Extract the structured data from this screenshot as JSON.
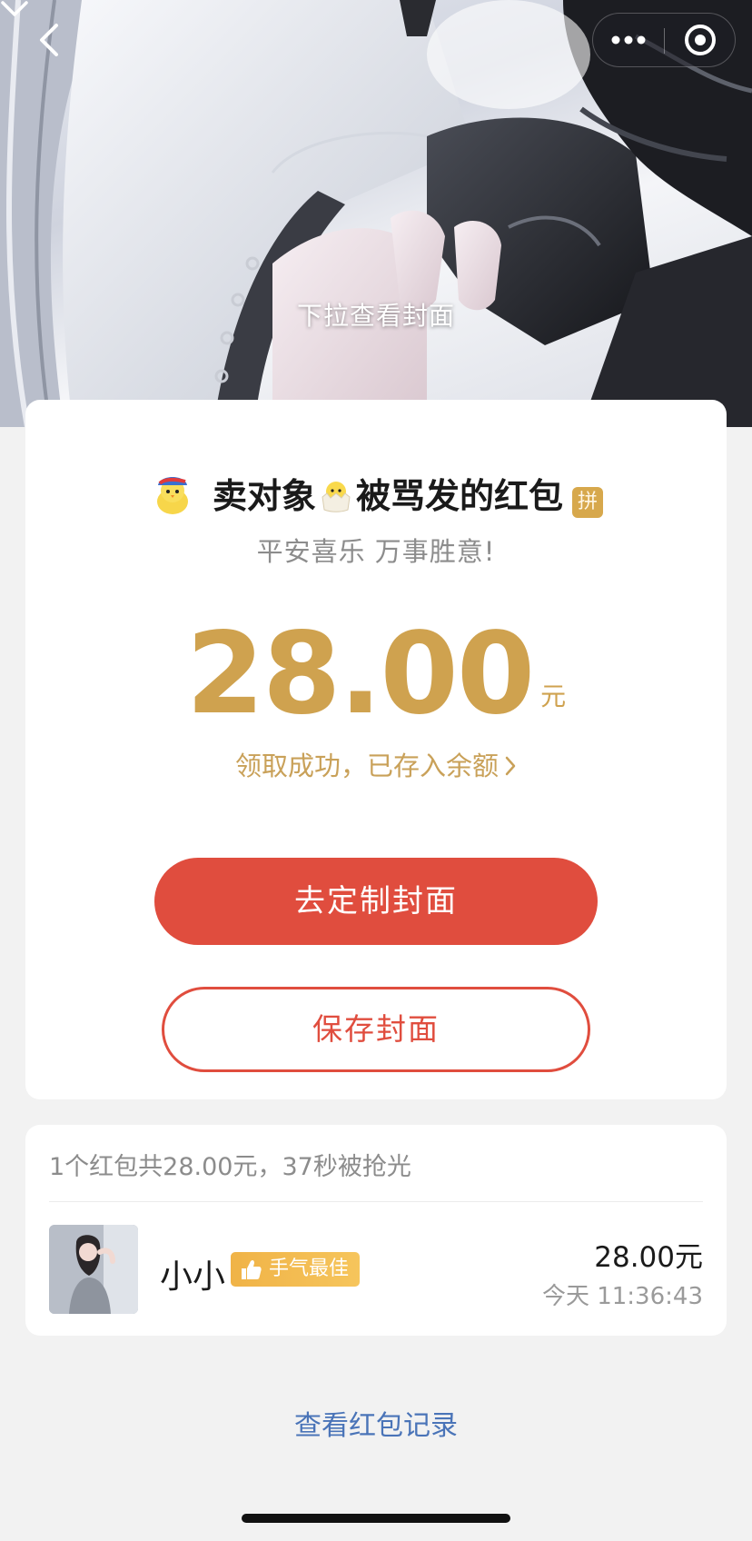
{
  "cover": {
    "pull_hint": "下拉查看封面"
  },
  "card": {
    "sender_title_part1": "卖对象",
    "sender_title_part2": "被骂发的红包",
    "pin_badge": "拼",
    "blessing": "平安喜乐 万事胜意!",
    "amount": "28.00",
    "unit": "元",
    "received_text": "领取成功，已存入余额",
    "custom_cover_button": "去定制封面",
    "save_cover_button": "保存封面"
  },
  "records": {
    "summary": "1个红包共28.00元，37秒被抢光",
    "items": [
      {
        "name": "小小",
        "badge": "手气最佳",
        "amount": "28.00元",
        "time": "今天 11:36:43"
      }
    ]
  },
  "history_link": "查看红包记录",
  "colors": {
    "gold": "#cfa24f",
    "red": "#e04d3e",
    "link_blue": "#4a74b8",
    "background": "#f2f2f2"
  }
}
